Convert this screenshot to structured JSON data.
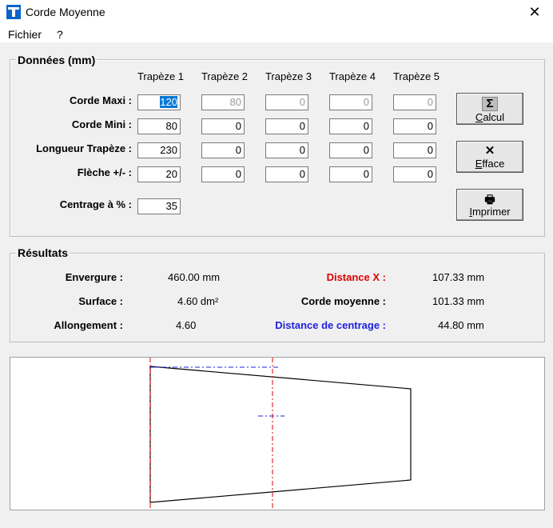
{
  "window": {
    "title": "Corde Moyenne",
    "close_glyph": "✕"
  },
  "menu": {
    "items": [
      "Fichier",
      "?"
    ]
  },
  "inputs": {
    "title": "Données (mm)",
    "columns": [
      "Trapèze 1",
      "Trapèze 2",
      "Trapèze 3",
      "Trapèze 4",
      "Trapèze 5"
    ],
    "rows": [
      {
        "label": "Corde Maxi :",
        "values": [
          "120",
          "80",
          "0",
          "0",
          "0"
        ]
      },
      {
        "label": "Corde Mini :",
        "values": [
          "80",
          "0",
          "0",
          "0",
          "0"
        ]
      },
      {
        "label": "Longueur Trapèze :",
        "values": [
          "230",
          "0",
          "0",
          "0",
          "0"
        ]
      },
      {
        "label": "Flèche  +/- :",
        "values": [
          "20",
          "0",
          "0",
          "0",
          "0"
        ]
      }
    ],
    "centrage": {
      "label": "Centrage à  % :",
      "value": "35"
    }
  },
  "buttons": {
    "calcul": {
      "icon": "Σ",
      "mnemonic": "C",
      "rest": "alcul"
    },
    "efface": {
      "icon": "✕",
      "mnemonic": "E",
      "rest": "fface"
    },
    "imprimer": {
      "icon": "🖶",
      "mnemonic": "I",
      "rest": "mprimer"
    }
  },
  "results": {
    "title": "Résultats",
    "left": [
      {
        "label": "Envergure :",
        "value": "460.00 mm"
      },
      {
        "label": "Surface :",
        "value": "4.60 dm²"
      },
      {
        "label": "Allongement :",
        "value": "4.60"
      }
    ],
    "right": [
      {
        "label": "Distance X :",
        "value": "107.33 mm",
        "color": "#e00000"
      },
      {
        "label": "Corde moyenne :",
        "value": "101.33 mm",
        "color": "#000000"
      },
      {
        "label": "Distance de centrage :",
        "value": "44.80 mm",
        "color": "#2020e0"
      }
    ]
  }
}
